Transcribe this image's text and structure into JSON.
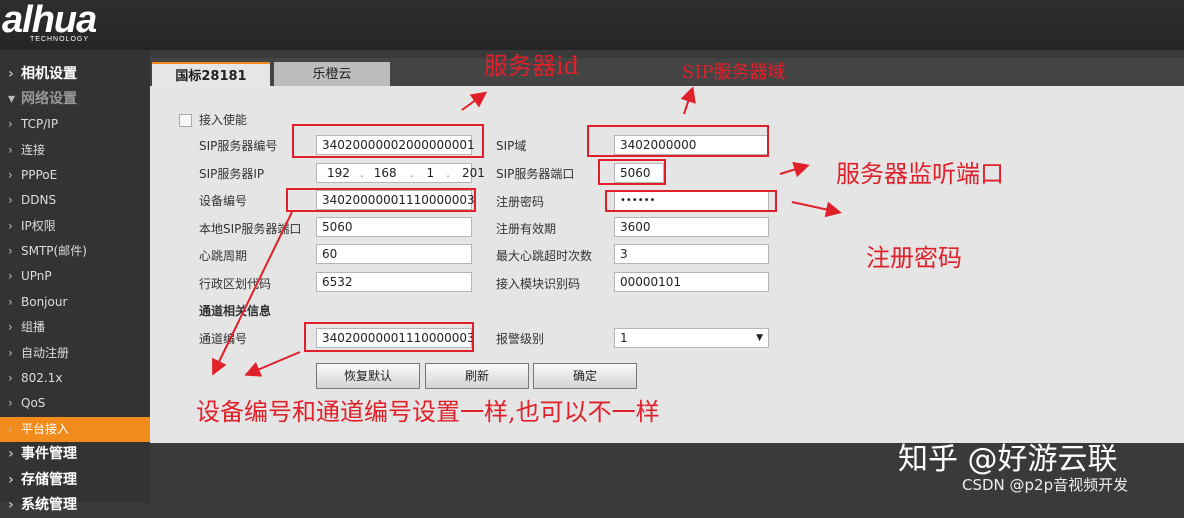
{
  "brand": {
    "logo": "alhua",
    "sub": "TECHNOLOGY"
  },
  "sidebar": {
    "items": [
      {
        "label": "相机设置",
        "kind": "section"
      },
      {
        "label": "网络设置",
        "kind": "muted"
      },
      {
        "label": "TCP/IP"
      },
      {
        "label": "连接"
      },
      {
        "label": "PPPoE"
      },
      {
        "label": "DDNS"
      },
      {
        "label": "IP权限"
      },
      {
        "label": "SMTP(邮件)"
      },
      {
        "label": "UPnP"
      },
      {
        "label": "Bonjour"
      },
      {
        "label": "组播"
      },
      {
        "label": "自动注册"
      },
      {
        "label": "802.1x"
      },
      {
        "label": "QoS"
      },
      {
        "label": "平台接入",
        "active": true
      },
      {
        "label": "事件管理",
        "kind": "section"
      },
      {
        "label": "存储管理",
        "kind": "section"
      },
      {
        "label": "系统管理",
        "kind": "section"
      }
    ]
  },
  "tabs": [
    "国标28181",
    "乐橙云"
  ],
  "form": {
    "enable_label": "接入使能",
    "sip_server_id_label": "SIP服务器编号",
    "sip_server_id_value": "34020000002000000001",
    "sip_domain_label": "SIP域",
    "sip_domain_value": "3402000000",
    "sip_server_ip_label": "SIP服务器IP",
    "sip_server_ip": [
      "192",
      "168",
      "1",
      "201"
    ],
    "sip_server_port_label": "SIP服务器端口",
    "sip_server_port_value": "5060",
    "device_id_label": "设备编号",
    "device_id_value": "34020000001110000003",
    "reg_password_label": "注册密码",
    "reg_password_value": "••••••",
    "local_port_label": "本地SIP服务器端口",
    "local_port_value": "5060",
    "reg_validity_label": "注册有效期",
    "reg_validity_value": "3600",
    "heartbeat_label": "心跳周期",
    "heartbeat_value": "60",
    "max_timeout_label": "最大心跳超时次数",
    "max_timeout_value": "3",
    "region_label": "行政区划代码",
    "region_value": "6532",
    "module_id_label": "接入模块识别码",
    "module_id_value": "00000101",
    "channel_section": "通道相关信息",
    "channel_id_label": "通道编号",
    "channel_id_value": "34020000001110000003",
    "alarm_level_label": "报警级别",
    "alarm_level_value": "1"
  },
  "buttons": {
    "restore": "恢复默认",
    "refresh": "刷新",
    "confirm": "确定"
  },
  "annotations": {
    "server_id": "服务器id",
    "sip_domain": "SIP服务器域",
    "listen_port": "服务器监听端口",
    "reg_password": "注册密码",
    "note": "设备编号和通道编号设置一样,也可以不一样"
  },
  "watermarks": {
    "zhihu": "知乎 @好游云联",
    "csdn": "CSDN @p2p音视频开发"
  },
  "colors": {
    "accent": "#f08b1c",
    "annotation": "#e0202a",
    "panel": "#e5e5e5"
  }
}
